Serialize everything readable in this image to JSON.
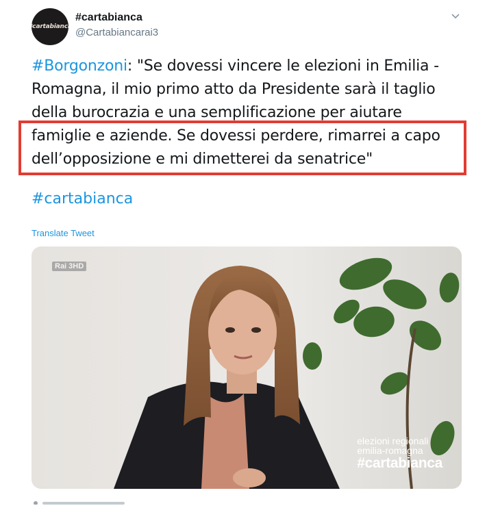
{
  "account": {
    "avatar_text": "#cartabianca",
    "display_name": "#cartabianca",
    "handle": "@Cartabiancarai3"
  },
  "tweet": {
    "mention_hashtag": "#Borgonzoni",
    "line1_rest": ": \"Se dovessi vincere le elezioni in Emilia -",
    "line2": "Romagna, il mio primo atto da Presidente sarà il taglio",
    "line3": "della burocrazia e una semplificazione per aiutare",
    "line4": "famiglie e aziende. Se dovessi perdere, rimarrei a capo",
    "line5": "dell’opposizione e mi dimetterei da senatrice\"",
    "hashtag": "#cartabianca",
    "translate_label": "Translate Tweet"
  },
  "media": {
    "channel_logo": "Rai 3HD",
    "overlay_line1": "elezioni regionali",
    "overlay_line2": "emilia-romagna",
    "overlay_line3": "#cartabianca"
  },
  "colors": {
    "link": "#1b95e0",
    "highlight_border": "#e23b32",
    "text": "#14171a",
    "secondary": "#657786"
  }
}
